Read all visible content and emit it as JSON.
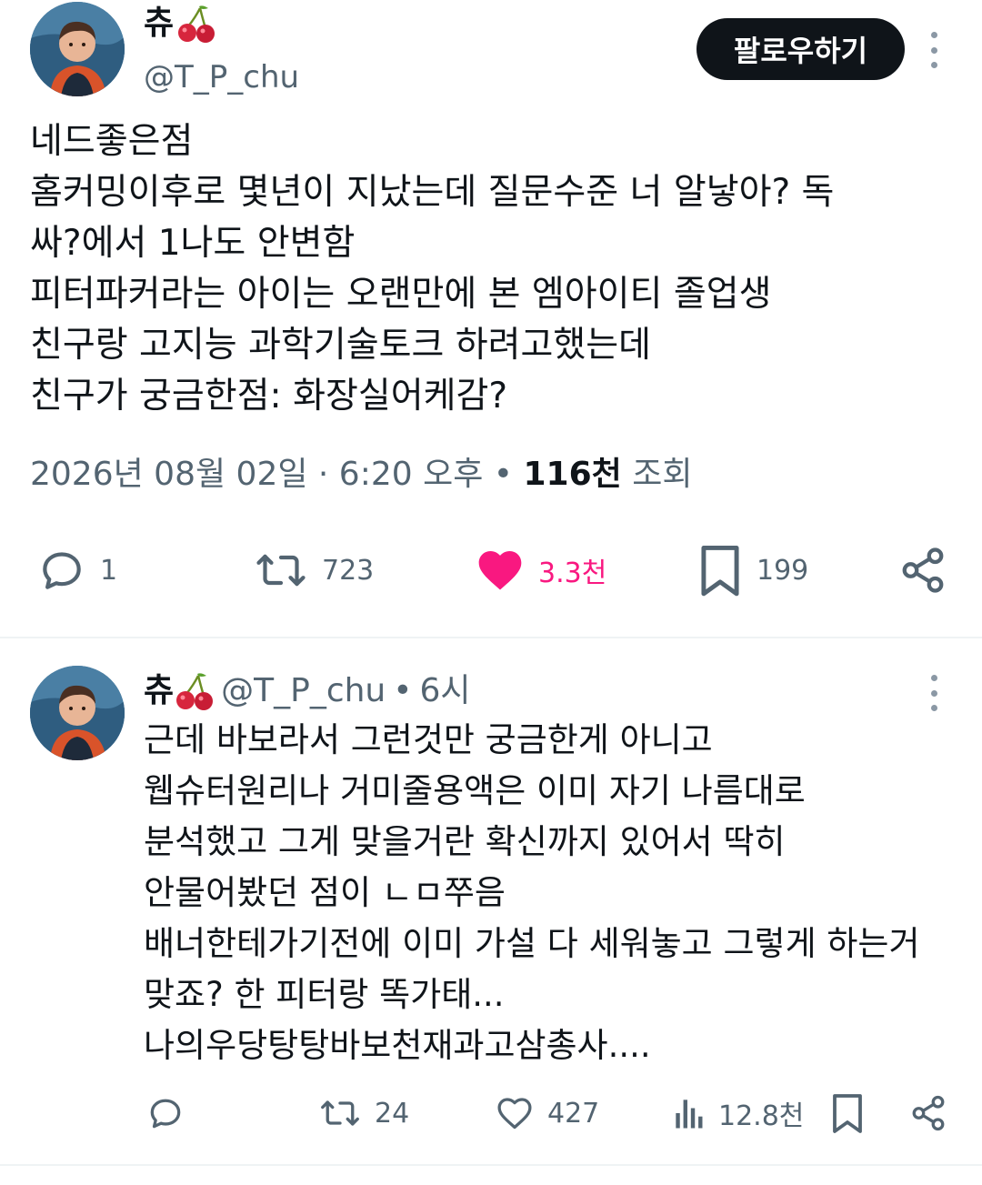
{
  "main_tweet": {
    "display_name": "츄",
    "handle": "@T_P_chu",
    "follow_label": "팔로우하기",
    "body_lines": [
      "네드좋은점",
      "홈커밍이후로 몇년이 지났는데 질문수준 너 알낳아? 독",
      "싸?에서 1나도 안변함",
      "피터파커라는 아이는 오랜만에 본 엠아이티 졸업생",
      "친구랑 고지능 과학기술토크 하려고했는데",
      "친구가 궁금한점: 화장실어케감?"
    ],
    "timestamp": "2026년 08월 02일 · 6:20 오후",
    "views_sep": " • ",
    "views_count": "116천",
    "views_label": " 조회",
    "stats": {
      "replies": "1",
      "retweets": "723",
      "likes": "3.3천",
      "bookmarks": "199"
    }
  },
  "reply": {
    "display_name": "츄",
    "handle": "@T_P_chu",
    "dot": "•",
    "time": "6시",
    "body_lines": [
      "근데 바보라서 그런것만 궁금한게 아니고",
      "웹슈터원리나 거미줄용액은 이미 자기 나름대로",
      "분석했고 그게 맞을거란 확신까지 있어서 딱히",
      "안물어봤던 점이 ㄴㅁ쭈음",
      "배너한테가기전에 이미 가설 다 세워놓고 그렇게 하는거",
      "맞죠? 한 피터랑 똑가태...",
      "나의우당탕탕바보천재과고삼총사...."
    ],
    "stats": {
      "retweets": "24",
      "likes": "427",
      "views": "12.8천"
    }
  },
  "colors": {
    "text": "#0f1419",
    "secondary": "#536471",
    "like_pink": "#f91880",
    "follow_bg": "#0f1419"
  },
  "icons": [
    "cherry-emoji-icon",
    "more-dots-icon",
    "reply-icon",
    "retweet-icon",
    "heart-filled-icon",
    "heart-outline-icon",
    "bookmark-icon",
    "share-icon",
    "views-chart-icon"
  ]
}
